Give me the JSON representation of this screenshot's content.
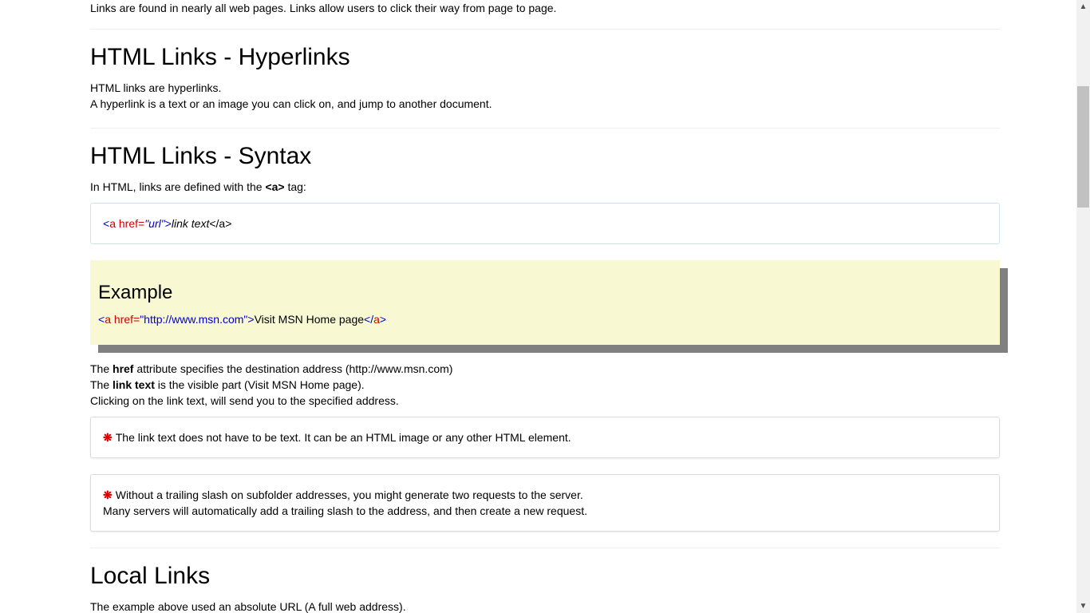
{
  "intro": {
    "text": "Links are found in nearly all web pages. Links allow users to click their way from page to page."
  },
  "section_hyperlinks": {
    "title": "HTML Links - Hyperlinks",
    "line1": "HTML links are hyperlinks.",
    "line2": "A hyperlink is a text or an image you can click on, and jump to another document."
  },
  "section_syntax": {
    "title": "HTML Links - Syntax",
    "intro_before": "In HTML, links are defined with the ",
    "intro_tag": "<a>",
    "intro_after": " tag:",
    "code": {
      "lt": "<",
      "tag": "a",
      "attr": " href=",
      "val": "\"url\"",
      "gt": ">",
      "text": "link text",
      "close": "</a>"
    }
  },
  "example": {
    "heading": "Example",
    "lt": "<",
    "tag": "a",
    "attr": " href=",
    "val": "\"http://www.msn.com\"",
    "gt": ">",
    "text": "Visit MSN Home page",
    "close_lt": "</",
    "close_tag": "a",
    "close_gt": ">"
  },
  "explanation": {
    "l1_before": "The ",
    "l1_bold": "href",
    "l1_after": " attribute specifies the destination address (http://www.msn.com)",
    "l2_before": "The ",
    "l2_bold": "link text",
    "l2_after": " is the visible part (Visit MSN Home page).",
    "l3": "Clicking on the link text, will send you to the specified address."
  },
  "note1": {
    "star": "❋",
    "text": "The link text does not have to be text. It can be an HTML image or any other HTML element."
  },
  "note2": {
    "star": "❋",
    "line1": "Without a trailing slash on subfolder addresses, you might generate two requests to the server.",
    "line2": "Many servers will automatically add a trailing slash to the address, and then create a new request."
  },
  "section_local": {
    "title": "Local Links",
    "line1": "The example above used an absolute URL (A full web address)."
  },
  "scrollbar": {
    "up": "▲",
    "down": "▼"
  },
  "colors": {
    "tag_red": "#cc0000",
    "value_blue": "#0000cd",
    "example_bg": "#f8f9d2",
    "note_star": "#e00000"
  }
}
